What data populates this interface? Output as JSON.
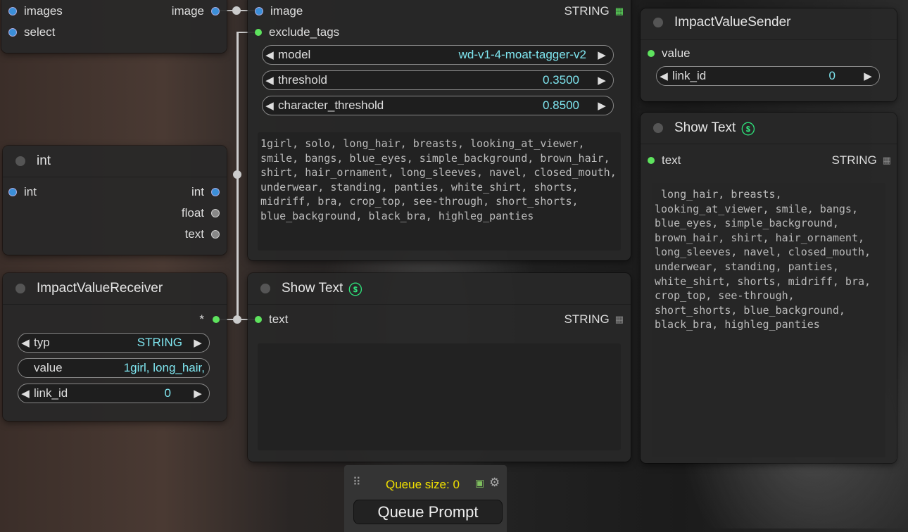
{
  "node_load": {
    "inputs": [
      "images",
      "select"
    ],
    "output": "image"
  },
  "node_int": {
    "title": "int",
    "input": "int",
    "outputs": [
      "int",
      "float",
      "text"
    ]
  },
  "node_receiver": {
    "title": "ImpactValueReceiver",
    "output": "*",
    "widgets": {
      "typ": {
        "label": "typ",
        "value": "STRING"
      },
      "value": {
        "label": "value",
        "value": "1girl, long_hair,"
      },
      "link_id": {
        "label": "link_id",
        "value": "0"
      }
    }
  },
  "node_tagger": {
    "inputs": [
      "image",
      "exclude_tags"
    ],
    "output_type": "STRING",
    "widgets": {
      "model": {
        "label": "model",
        "value": "wd-v1-4-moat-tagger-v2"
      },
      "threshold": {
        "label": "threshold",
        "value": "0.3500"
      },
      "character_threshold": {
        "label": "character_threshold",
        "value": "0.8500"
      }
    },
    "text": "1girl, solo, long_hair, breasts, looking_at_viewer, smile, bangs, blue_eyes, simple_background, brown_hair, shirt, hair_ornament, long_sleeves, navel, closed_mouth, underwear, standing, panties, white_shirt, shorts, midriff, bra, crop_top, see-through, short_shorts, blue_background, black_bra, highleg_panties"
  },
  "node_showtext_mid": {
    "title": "Show Text",
    "input": "text",
    "output_type": "STRING",
    "text": ""
  },
  "node_sender": {
    "title": "ImpactValueSender",
    "input": "value",
    "widgets": {
      "link_id": {
        "label": "link_id",
        "value": "0"
      }
    }
  },
  "node_showtext_right": {
    "title": "Show Text",
    "input": "text",
    "output_type": "STRING",
    "text": " long_hair, breasts, looking_at_viewer, smile, bangs, blue_eyes, simple_background, brown_hair, shirt, hair_ornament, long_sleeves, navel, closed_mouth, underwear, standing, panties, white_shirt, shorts, midriff, bra, crop_top, see-through, short_shorts, blue_background, black_bra, highleg_panties"
  },
  "queue": {
    "size_label": "Queue size: 0",
    "button_label": "Queue Prompt"
  },
  "colors": {
    "accent_green": "#5ee35e",
    "value_cyan": "#7fe6f0",
    "queue_yellow": "#f0e000",
    "pysss_icon": "#2ee07a"
  },
  "icons": [
    "grid-icon",
    "pysssss-icon",
    "image-icon",
    "gear-icon",
    "drag-handle-icon",
    "arrow-left-icon",
    "arrow-right-icon"
  ]
}
